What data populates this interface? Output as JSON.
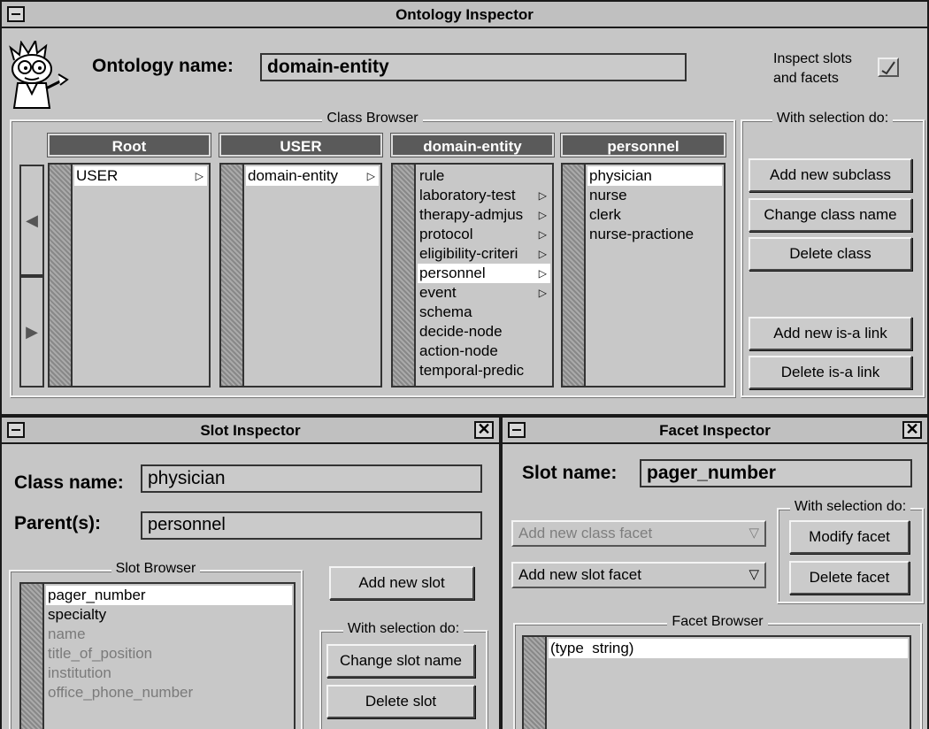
{
  "ontology_window": {
    "title": "Ontology Inspector",
    "ontology_name_label": "Ontology name:",
    "ontology_name_value": "domain-entity",
    "inspect_label_line1": "Inspect slots",
    "inspect_label_line2": "and facets",
    "inspect_checked": true,
    "class_browser": {
      "title": "Class Browser",
      "columns": [
        {
          "header": "Root",
          "items": [
            {
              "label": "USER",
              "arrow": true,
              "selected": true
            }
          ]
        },
        {
          "header": "USER",
          "items": [
            {
              "label": "domain-entity",
              "arrow": true,
              "selected": true
            }
          ]
        },
        {
          "header": "domain-entity",
          "items": [
            {
              "label": "rule",
              "arrow": false,
              "selected": false
            },
            {
              "label": "laboratory-test",
              "arrow": true,
              "selected": false
            },
            {
              "label": "therapy-admjus",
              "arrow": true,
              "selected": false
            },
            {
              "label": "protocol",
              "arrow": true,
              "selected": false
            },
            {
              "label": "eligibility-criteri",
              "arrow": true,
              "selected": false
            },
            {
              "label": "personnel",
              "arrow": true,
              "selected": true
            },
            {
              "label": "event",
              "arrow": true,
              "selected": false
            },
            {
              "label": "schema",
              "arrow": false,
              "selected": false
            },
            {
              "label": "decide-node",
              "arrow": false,
              "selected": false
            },
            {
              "label": "action-node",
              "arrow": false,
              "selected": false
            },
            {
              "label": "temporal-predic",
              "arrow": false,
              "selected": false
            }
          ]
        },
        {
          "header": "personnel",
          "items": [
            {
              "label": "physician",
              "arrow": false,
              "selected": true
            },
            {
              "label": "nurse",
              "arrow": false,
              "selected": false
            },
            {
              "label": "clerk",
              "arrow": false,
              "selected": false
            },
            {
              "label": "nurse-practione",
              "arrow": false,
              "selected": false
            }
          ]
        }
      ]
    },
    "selection_group": {
      "title": "With selection do:",
      "add_subclass": "Add new subclass",
      "change_class_name": "Change class name",
      "delete_class": "Delete class",
      "add_isa_link": "Add new is-a link",
      "delete_isa_link": "Delete is-a link"
    }
  },
  "slot_window": {
    "title": "Slot Inspector",
    "class_name_label": "Class name:",
    "class_name_value": "physician",
    "parents_label": "Parent(s):",
    "parents_value": "personnel",
    "slot_browser_title": "Slot Browser",
    "slots": [
      {
        "label": "pager_number",
        "selected": true,
        "dim": false
      },
      {
        "label": "specialty",
        "selected": false,
        "dim": false
      },
      {
        "label": "name",
        "selected": false,
        "dim": true
      },
      {
        "label": "title_of_position",
        "selected": false,
        "dim": true
      },
      {
        "label": "institution",
        "selected": false,
        "dim": true
      },
      {
        "label": "office_phone_number",
        "selected": false,
        "dim": true
      }
    ],
    "add_slot": "Add new slot",
    "selection_title": "With selection do:",
    "change_slot_name": "Change slot name",
    "delete_slot": "Delete slot"
  },
  "facet_window": {
    "title": "Facet Inspector",
    "slot_name_label": "Slot name:",
    "slot_name_value": "pager_number",
    "add_class_facet": "Add new class facet",
    "add_slot_facet": "Add new slot facet",
    "selection_title": "With selection do:",
    "modify_facet": "Modify facet",
    "delete_facet": "Delete facet",
    "facet_browser_title": "Facet Browser",
    "facets": [
      {
        "label": "(type  string)",
        "selected": true
      }
    ]
  }
}
